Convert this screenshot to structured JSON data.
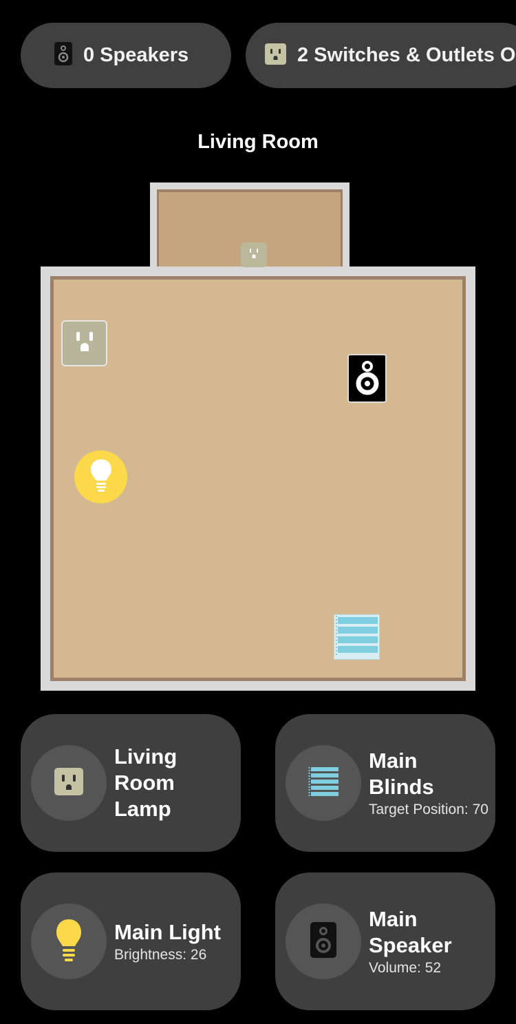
{
  "filters": {
    "speakers_label": "0 Speakers",
    "switches_label": "2 Switches & Outlets O"
  },
  "room": {
    "title": "Living Room"
  },
  "floor_plan": {
    "devices": [
      {
        "icon": "outlet-icon"
      },
      {
        "icon": "outlet-icon"
      },
      {
        "icon": "speaker-icon"
      },
      {
        "icon": "lightbulb-icon"
      },
      {
        "icon": "blinds-icon"
      }
    ]
  },
  "cards": [
    {
      "title": "Living Room Lamp",
      "subtitle": "",
      "icon": "outlet-icon"
    },
    {
      "title": "Main Blinds",
      "subtitle": "Target Position: 70",
      "icon": "blinds-icon"
    },
    {
      "title": "Main Light",
      "subtitle": "Brightness: 26",
      "icon": "lightbulb-icon"
    },
    {
      "title": "Main Speaker",
      "subtitle": "Volume: 52",
      "icon": "speaker-icon"
    }
  ],
  "colors": {
    "background": "#000000",
    "card": "#3f3f3f",
    "floor": "#d4b891",
    "wall": "#d9d9d9",
    "outlet": "#b7b69b",
    "bulb": "#fbd94a",
    "blinds": "#7fcfe0"
  }
}
